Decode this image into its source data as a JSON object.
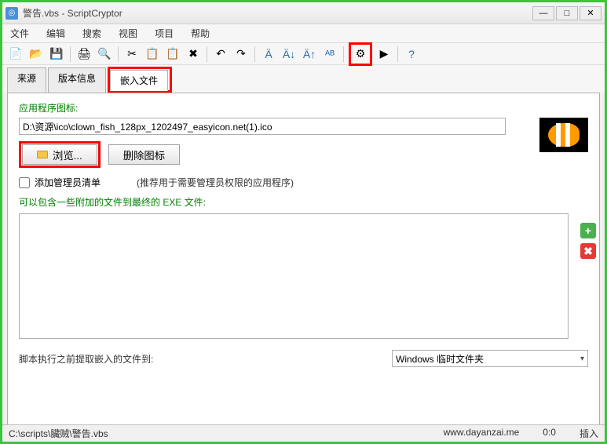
{
  "title": "警告.vbs - ScriptCryptor",
  "menu": {
    "file": "文件",
    "edit": "编辑",
    "search": "搜索",
    "view": "视图",
    "project": "项目",
    "help": "帮助"
  },
  "tabs": {
    "source": "来源",
    "version": "版本信息",
    "embed": "嵌入文件"
  },
  "labels": {
    "appIcon": "应用程序图标:",
    "browse": "浏览...",
    "deleteIcon": "删除图标",
    "addManifest": "添加管理员清单",
    "manifestHint": "(推荐用于需要管理员权限的应用程序)",
    "includeFiles": "可以包含一些附加的文件到最终的 EXE 文件:",
    "extractTo": "脚本执行之前提取嵌入的文件到:"
  },
  "values": {
    "iconPath": "D:\\资源\\ico\\clown_fish_128px_1202497_easyicon.net(1).ico",
    "extractTarget": "Windows 临时文件夹"
  },
  "status": {
    "path": "C:\\scripts\\臟贼\\警告.vbs",
    "site": "www.dayanzai.me",
    "pos": "0:0",
    "mode": "插入"
  }
}
